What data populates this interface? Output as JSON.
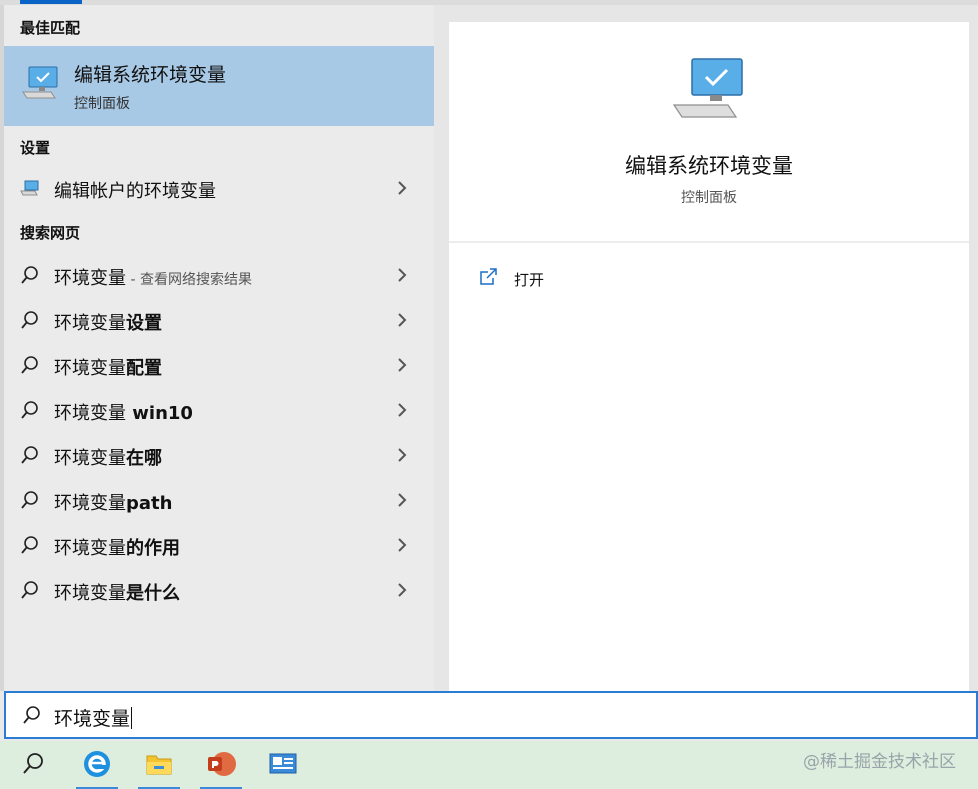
{
  "left": {
    "best_match_heading": "最佳匹配",
    "best_match": {
      "title": "编辑系统环境变量",
      "subtitle": "控制面板"
    },
    "settings_heading": "设置",
    "settings_item": {
      "label": "编辑帐户的环境变量"
    },
    "web_heading": "搜索网页",
    "web_items": [
      {
        "term": "环境变量",
        "suffix": "",
        "hint": " - 查看网络搜索结果"
      },
      {
        "term": "环境变量",
        "suffix": "设置",
        "hint": ""
      },
      {
        "term": "环境变量",
        "suffix": "配置",
        "hint": ""
      },
      {
        "term": "环境变量",
        "suffix": " win10",
        "hint": ""
      },
      {
        "term": "环境变量",
        "suffix": "在哪",
        "hint": ""
      },
      {
        "term": "环境变量",
        "suffix": "path",
        "hint": ""
      },
      {
        "term": "环境变量",
        "suffix": "的作用",
        "hint": ""
      },
      {
        "term": "环境变量",
        "suffix": "是什么",
        "hint": ""
      }
    ]
  },
  "right": {
    "title": "编辑系统环境变量",
    "subtitle": "控制面板",
    "actions": [
      {
        "label": "打开",
        "icon": "open-icon"
      }
    ]
  },
  "search": {
    "value": "环境变量",
    "icon": "search-icon"
  },
  "taskbar": {
    "icons": [
      "search-icon",
      "edge-icon",
      "file-explorer-icon",
      "powerpoint-icon",
      "control-panel-icon"
    ],
    "watermark": "@稀土掘金技术社区"
  },
  "colors": {
    "accent": "#0a64c8",
    "selected": "#a8c9e6",
    "search_border": "#2a7cd4"
  }
}
